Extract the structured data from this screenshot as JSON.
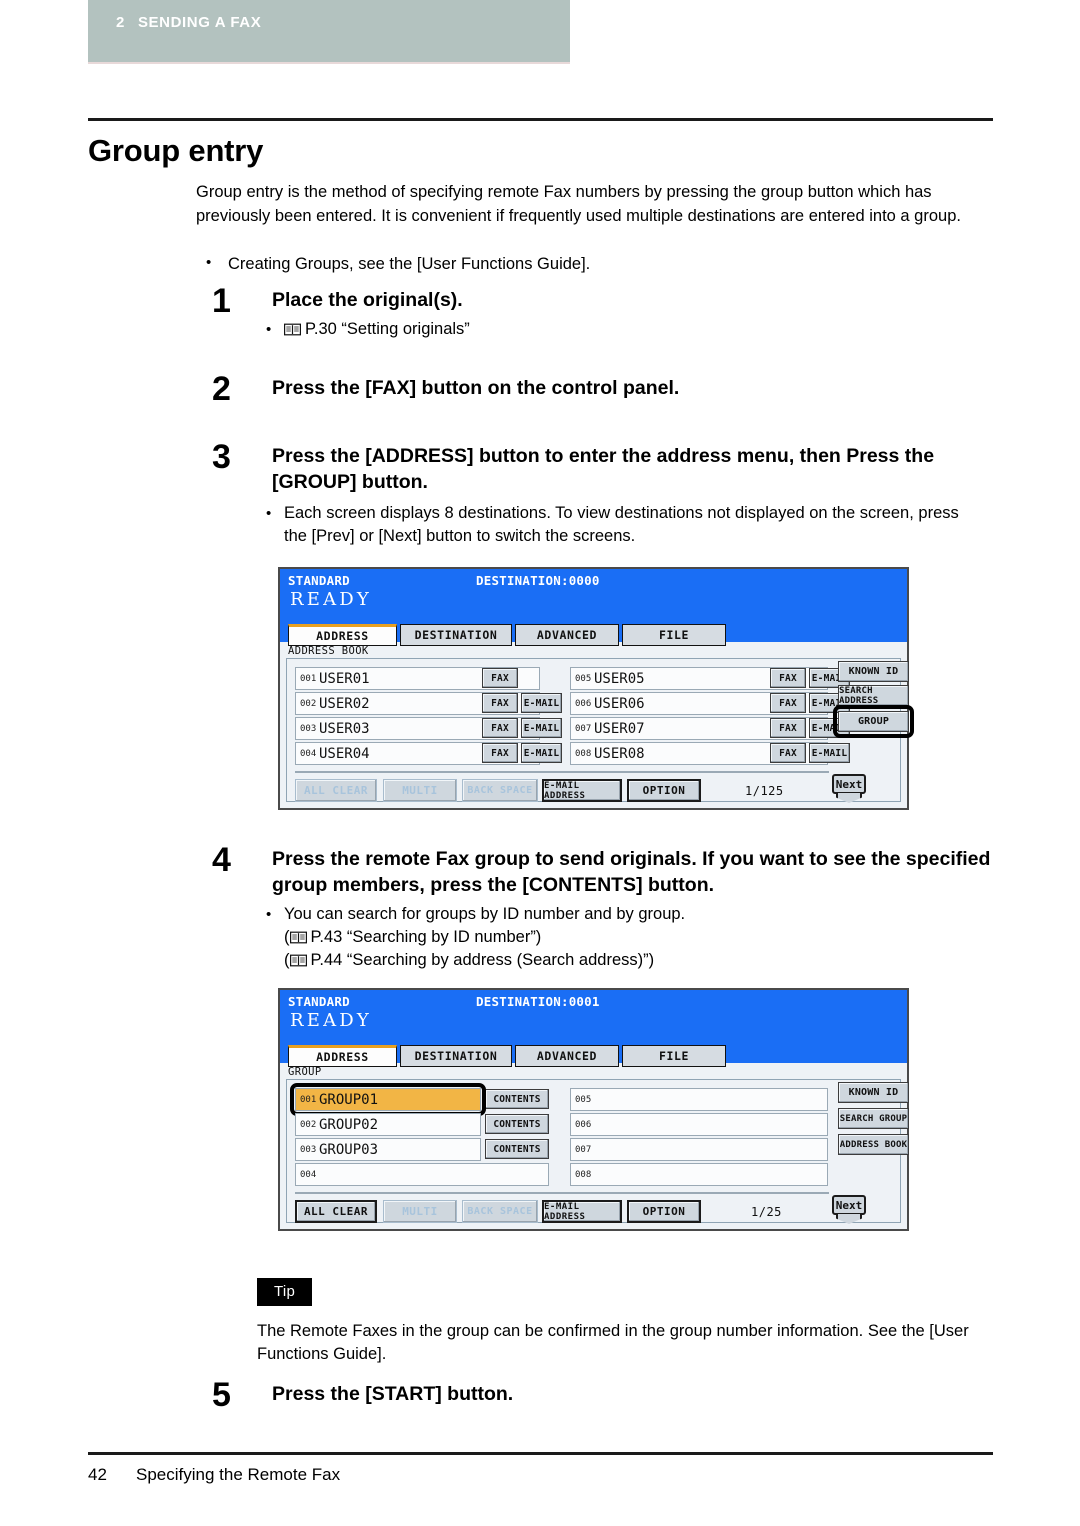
{
  "running_header": {
    "chapter_number": "2",
    "chapter_title": "SENDING A FAX"
  },
  "page_title": "Group entry",
  "intro": {
    "paragraph": "Group entry is the method of specifying remote Fax numbers by pressing the group button which has previously been entered. It is convenient if frequently used multiple destinations are entered into a group.",
    "bullet": "Creating Groups, see the [User Functions Guide]."
  },
  "steps": [
    {
      "number": "1",
      "title": "Place the original(s).",
      "sub_prefix": "P.30 ",
      "sub_quote": "“Setting originals”"
    },
    {
      "number": "2",
      "title": "Press the [FAX] button on the control panel."
    },
    {
      "number": "3",
      "title": "Press the [ADDRESS] button to enter the address menu, then Press the [GROUP] button.",
      "sub": "Each screen displays 8 destinations. To view destinations not displayed on the screen, press the [Prev] or [Next] button to switch the screens."
    },
    {
      "number": "4",
      "title": "Press the remote Fax group to send originals. If you want to see the specified group members, press the [CONTENTS] button.",
      "sub": "You can search for groups by ID number and by group.",
      "ref1_prefix": "(",
      "ref1": "P.43 “Searching by ID number”)",
      "ref2_prefix": "(",
      "ref2": "P.44 “Searching by address (Search address)”)"
    },
    {
      "number": "5",
      "title": "Press the [START] button."
    }
  ],
  "lcd_address": {
    "status_left": "STANDARD",
    "status_right": "DESTINATION:0000",
    "ready": "READY",
    "tabs": [
      {
        "label": "ADDRESS",
        "active": true
      },
      {
        "label": "DESTINATION",
        "active": false
      },
      {
        "label": "ADVANCED",
        "active": false
      },
      {
        "label": "FILE",
        "active": false
      }
    ],
    "section_label": "ADDRESS BOOK",
    "left_entries": [
      {
        "idx": "001",
        "name": "USER01",
        "fax": "FAX",
        "email": ""
      },
      {
        "idx": "002",
        "name": "USER02",
        "fax": "FAX",
        "email": "E-MAIL"
      },
      {
        "idx": "003",
        "name": "USER03",
        "fax": "FAX",
        "email": "E-MAIL"
      },
      {
        "idx": "004",
        "name": "USER04",
        "fax": "FAX",
        "email": "E-MAIL"
      }
    ],
    "right_entries": [
      {
        "idx": "005",
        "name": "USER05",
        "fax": "FAX",
        "email": "E-MAIL"
      },
      {
        "idx": "006",
        "name": "USER06",
        "fax": "FAX",
        "email": "E-MAIL"
      },
      {
        "idx": "007",
        "name": "USER07",
        "fax": "FAX",
        "email": "E-MAIL"
      },
      {
        "idx": "008",
        "name": "USER08",
        "fax": "FAX",
        "email": "E-MAIL"
      }
    ],
    "side_buttons": [
      {
        "label": "KNOWN ID",
        "highlighted": false
      },
      {
        "label": "SEARCH ADDRESS",
        "highlighted": false
      },
      {
        "label": "GROUP",
        "highlighted": true
      }
    ],
    "bottom_buttons": [
      {
        "label": "ALL CLEAR",
        "disabled": true,
        "strong": false
      },
      {
        "label": "MULTI",
        "disabled": true,
        "strong": false
      },
      {
        "label": "BACK SPACE",
        "disabled": true,
        "strong": false
      },
      {
        "label": "E-MAIL ADDRESS",
        "disabled": false,
        "strong": true
      },
      {
        "label": "OPTION",
        "disabled": false,
        "strong": true
      }
    ],
    "page_indicator": "1/125",
    "next_label": "Next"
  },
  "lcd_group": {
    "status_left": "STANDARD",
    "status_right": "DESTINATION:0001",
    "ready": "READY",
    "tabs": [
      {
        "label": "ADDRESS",
        "active": true
      },
      {
        "label": "DESTINATION",
        "active": false
      },
      {
        "label": "ADVANCED",
        "active": false
      },
      {
        "label": "FILE",
        "active": false
      }
    ],
    "section_label": "GROUP",
    "left_entries": [
      {
        "idx": "001",
        "name": "GROUP01",
        "contents": "CONTENTS",
        "selected": true
      },
      {
        "idx": "002",
        "name": "GROUP02",
        "contents": "CONTENTS",
        "selected": false
      },
      {
        "idx": "003",
        "name": "GROUP03",
        "contents": "CONTENTS",
        "selected": false
      },
      {
        "idx": "004",
        "name": "",
        "contents": "",
        "selected": false
      }
    ],
    "right_entries": [
      {
        "idx": "005",
        "name": ""
      },
      {
        "idx": "006",
        "name": ""
      },
      {
        "idx": "007",
        "name": ""
      },
      {
        "idx": "008",
        "name": ""
      }
    ],
    "side_buttons": [
      {
        "label": "KNOWN ID",
        "highlighted": false
      },
      {
        "label": "SEARCH GROUP",
        "highlighted": false
      },
      {
        "label": "ADDRESS BOOK",
        "highlighted": false
      }
    ],
    "bottom_buttons": [
      {
        "label": "ALL CLEAR",
        "disabled": false,
        "strong": true
      },
      {
        "label": "MULTI",
        "disabled": true,
        "strong": false
      },
      {
        "label": "BACK SPACE",
        "disabled": true,
        "strong": false
      },
      {
        "label": "E-MAIL ADDRESS",
        "disabled": false,
        "strong": true
      },
      {
        "label": "OPTION",
        "disabled": false,
        "strong": true
      }
    ],
    "page_indicator": "1/25",
    "next_label": "Next"
  },
  "tip": {
    "badge": "Tip",
    "text": "The Remote Faxes in the group can be confirmed in the group number information. See the [User Functions Guide]."
  },
  "footer": {
    "page_number": "42",
    "section": "Specifying the Remote Fax"
  },
  "colors": {
    "chapter_bar": "#b3c2bf",
    "lcd_blue": "#1a6ef5",
    "tab_active_accent": "#e8a020",
    "selected_entry": "#f2b545",
    "button_face": "#cfd7de",
    "disabled_text": "#a8c4dc"
  }
}
